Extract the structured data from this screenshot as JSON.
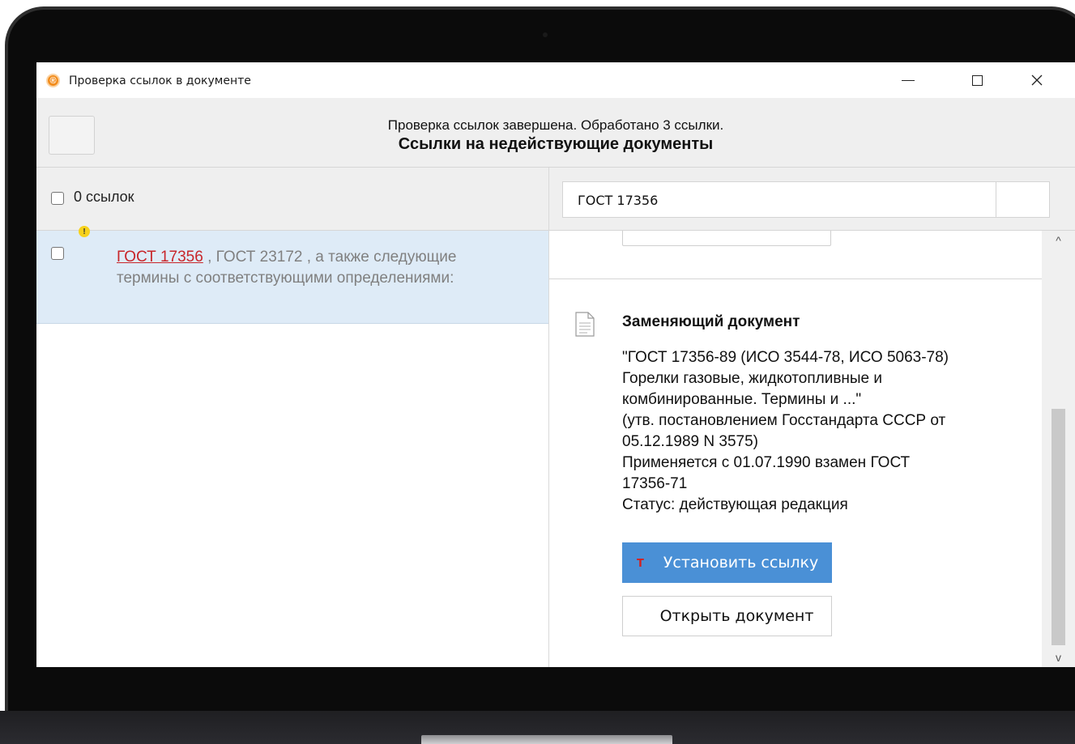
{
  "window": {
    "title": "Проверка ссылок в документе",
    "app_icon_glyph": "®",
    "app_icon_color": "#f28c1c"
  },
  "header": {
    "status": "Проверка ссылок завершена. Обработано 3 ссылки.",
    "title": "Ссылки на недействующие документы"
  },
  "left_pane": {
    "count_label": "0 ссылок",
    "items": [
      {
        "link_text": "ГОСТ 17356",
        "rest_text": " , ГОСТ 23172 , а также следующие термины с соответствующими определениями:",
        "checked": false,
        "warning_icon": "warning-icon"
      }
    ]
  },
  "right_pane": {
    "search_value": "ГОСТ 17356",
    "section_title": "Заменяющий документ",
    "doc_lines": [
      "\"ГОСТ 17356-89 (ИСО 3544-78, ИСО 5063-78)",
      "Горелки газовые, жидкотопливные и",
      "комбинированные. Термины и ...\"",
      "(утв. постановлением Госстандарта СССР от",
      "05.12.1989 N 3575)",
      "Применяется с 01.07.1990 взамен ГОСТ",
      "17356-71",
      "Статус: действующая редакция"
    ],
    "primary_button": "Установить ссылку",
    "secondary_button": "Открыть документ",
    "accent_color": "#4a90d6"
  }
}
